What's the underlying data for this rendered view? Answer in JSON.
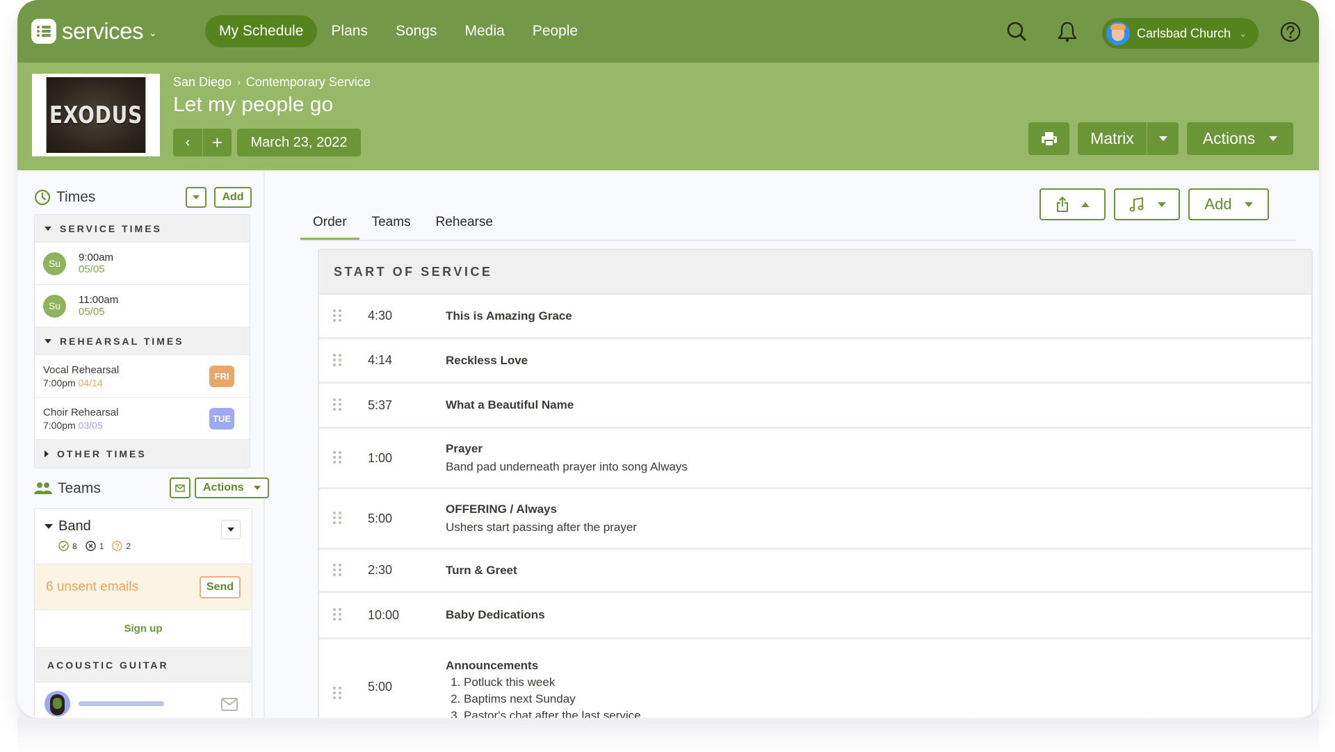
{
  "app": {
    "brand": "services",
    "nav": [
      "My Schedule",
      "Plans",
      "Songs",
      "Media",
      "People"
    ],
    "active_nav": "My Schedule",
    "org_name": "Carlsbad Church",
    "icons": {
      "search": "search-icon",
      "notifications": "bell-icon",
      "help": "help-icon"
    }
  },
  "plan": {
    "artwork_text": "EXODUS",
    "breadcrumb": [
      "San Diego",
      "Contemporary Service"
    ],
    "breadcrumb_sep": "›",
    "title": "Let my people go",
    "prev_label": "‹",
    "add_label": "+",
    "date": "March 23, 2022",
    "matrix_label": "Matrix",
    "actions_label": "Actions"
  },
  "sidebar": {
    "times": {
      "title": "Times",
      "add_label": "Add",
      "service_header": "SERVICE TIMES",
      "service_times": [
        {
          "day": "Su",
          "time": "9:00am",
          "date": "05/05"
        },
        {
          "day": "Su",
          "time": "11:00am",
          "date": "05/05"
        }
      ],
      "rehearsal_header": "REHEARSAL TIMES",
      "rehearsals": [
        {
          "name": "Vocal Rehearsal",
          "time": "7:00pm",
          "date": "04/14",
          "day": "FRI",
          "color": "#e8a86a"
        },
        {
          "name": "Choir Rehearsal",
          "time": "7:00pm",
          "date": "03/05",
          "day": "TUE",
          "color": "#9ea9f4"
        }
      ],
      "other_header": "OTHER TIMES"
    },
    "teams": {
      "title": "Teams",
      "actions_label": "Actions",
      "band": {
        "name": "Band",
        "confirmed": "8",
        "declined": "1",
        "unconfirmed": "2"
      },
      "unsent_text": "6 unsent emails",
      "send_label": "Send",
      "signup_label": "Sign up",
      "position_header": "ACOUSTIC GUITAR"
    }
  },
  "main": {
    "tabs": [
      "Order",
      "Teams",
      "Rehearse"
    ],
    "active_tab": "Order",
    "add_label": "Add",
    "section_header": "START OF SERVICE",
    "items": [
      {
        "length": "4:30",
        "title": "This is Amazing Grace",
        "desc": ""
      },
      {
        "length": "4:14",
        "title": "Reckless Love",
        "desc": ""
      },
      {
        "length": "5:37",
        "title": "What a Beautiful Name",
        "desc": ""
      },
      {
        "length": "1:00",
        "title": "Prayer",
        "desc": "Band pad underneath prayer into song Always"
      },
      {
        "length": "5:00",
        "title": "OFFERING / Always",
        "desc": "Ushers start passing after the prayer"
      },
      {
        "length": "2:30",
        "title": "Turn & Greet",
        "desc": ""
      },
      {
        "length": "10:00",
        "title": "Baby Dedications",
        "desc": ""
      },
      {
        "length": "5:00",
        "title": "Announcements",
        "list": [
          "Potluck this week",
          "Baptims next Sunday",
          "Pastor's chat after the last service"
        ]
      }
    ]
  },
  "colors": {
    "topnav": "#739847",
    "planbar": "#97b967",
    "accent": "#6b9638",
    "active_pill": "#55841f"
  }
}
